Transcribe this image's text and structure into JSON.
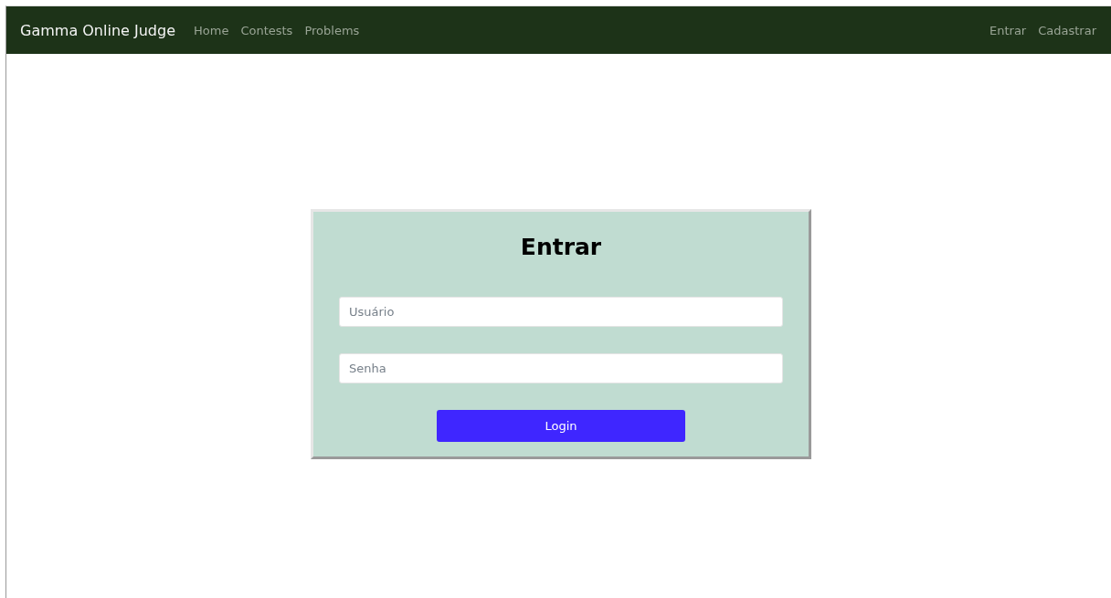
{
  "navbar": {
    "brand": "Gamma Online Judge",
    "links": [
      {
        "label": "Home"
      },
      {
        "label": "Contests"
      },
      {
        "label": "Problems"
      }
    ],
    "right_links": [
      {
        "label": "Entrar"
      },
      {
        "label": "Cadastrar"
      }
    ]
  },
  "login_card": {
    "title": "Entrar",
    "fields": [
      {
        "placeholder": "Usuário"
      },
      {
        "placeholder": "Senha"
      }
    ],
    "button": "Login"
  }
}
